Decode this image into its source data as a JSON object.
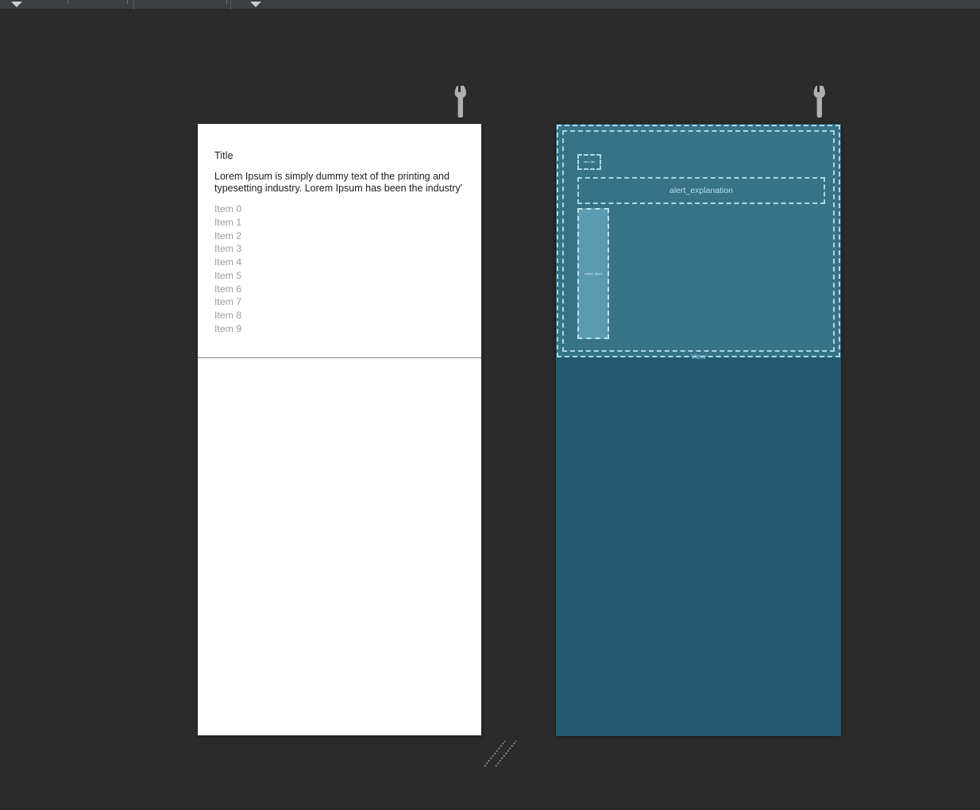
{
  "window": {
    "background_color": "#2b2b2b",
    "toolbar_background": "#3c3f41"
  },
  "toolbar": {
    "dropdown_left_icon": "chevron-down-icon",
    "dropdown_right_icon": "chevron-down-icon",
    "separator_icon": "vertical-separator"
  },
  "design_surface": {
    "name": "design-preview",
    "background_color": "#ffffff",
    "title": "Title",
    "body_text": "Lorem Ipsum is simply dummy text of the printing and typesetting industry. Lorem Ipsum has been the industry'",
    "items": [
      "Item 0",
      "Item 1",
      "Item 2",
      "Item 3",
      "Item 4",
      "Item 5",
      "Item 6",
      "Item 7",
      "Item 8",
      "Item 9"
    ],
    "item_color": "#9b9b9b",
    "title_color": "#1c1c1c"
  },
  "blueprint_surface": {
    "name": "blueprint-preview",
    "background_color": "#255b70",
    "panel_color": "#377286",
    "outline_color": "#a8d8e8",
    "highlight_color": "#5a9bb0",
    "root_label": "View",
    "nodes": [
      {
        "id": "alert_title",
        "label": "alert_title"
      },
      {
        "id": "alert_explanation",
        "label": "alert_explanation"
      },
      {
        "id": "options_layout",
        "label": "options_layout"
      }
    ]
  },
  "tool_handles": {
    "left_wrench_icon": "wrench-icon",
    "right_wrench_icon": "wrench-icon",
    "resize_icon": "resize-diagonal-icon",
    "icon_color": "#b0b0b0"
  }
}
